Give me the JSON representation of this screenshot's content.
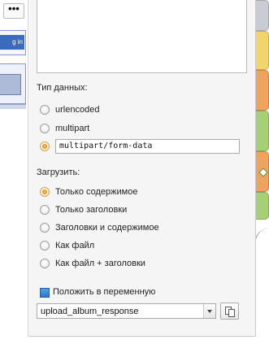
{
  "background": {
    "toolbar_button_label": "•••",
    "card_header_text": "g in"
  },
  "panel": {
    "data_type_label": "Тип данных:",
    "data_type_options": [
      {
        "label": "urlencoded",
        "selected": false
      },
      {
        "label": "multipart",
        "selected": false
      },
      {
        "label": "",
        "selected": true
      }
    ],
    "custom_content_type_value": "multipart/form-data",
    "load_label": "Загрузить:",
    "load_options": [
      {
        "label": "Только содержимое",
        "selected": true
      },
      {
        "label": "Только заголовки",
        "selected": false
      },
      {
        "label": "Заголовки и содержимое",
        "selected": false
      },
      {
        "label": "Как файл",
        "selected": false
      },
      {
        "label": "Как файл + заголовки",
        "selected": false
      }
    ],
    "save_to_variable_label": "Положить в переменную",
    "save_to_variable_checked": true,
    "variable_name": "upload_album_response",
    "accent_color": "#f0b43a"
  }
}
